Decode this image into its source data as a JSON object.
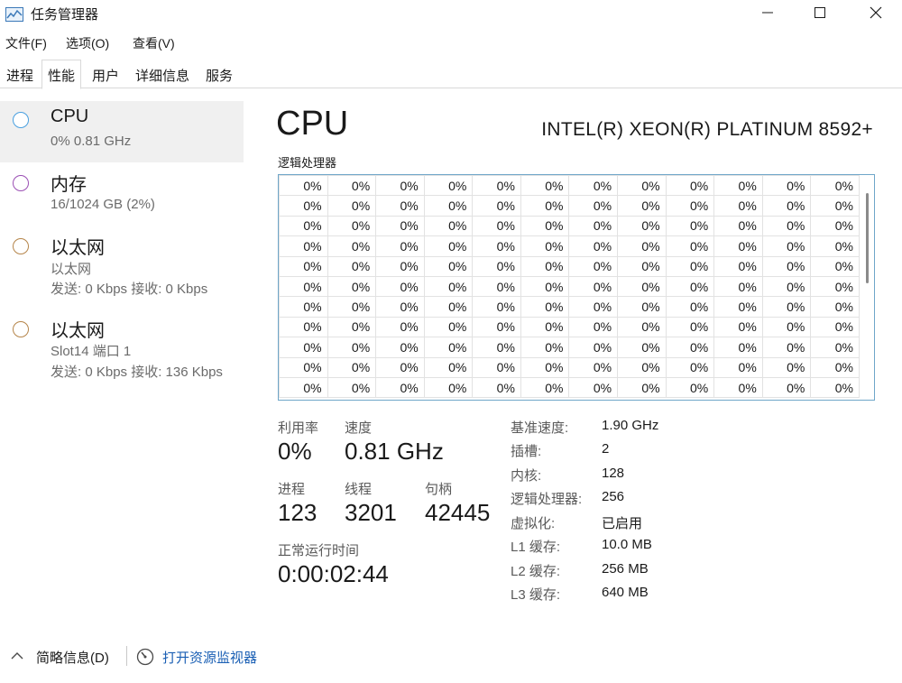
{
  "window": {
    "title": "任务管理器",
    "app_icon": "task-manager-icon",
    "controls": [
      "minimize-icon",
      "maximize-icon",
      "close-icon"
    ]
  },
  "menu": {
    "items": [
      "文件(F)",
      "选项(O)",
      "查看(V)"
    ]
  },
  "tabs": {
    "items": [
      "进程",
      "性能",
      "用户",
      "详细信息",
      "服务"
    ],
    "active": "性能"
  },
  "sidebar": {
    "items": [
      {
        "title": "CPU",
        "sub1": "0%  0.81 GHz",
        "sub2": "",
        "circle_color": "#4aa0e0",
        "selected": true
      },
      {
        "title": "内存",
        "sub1": "16/1024 GB (2%)",
        "sub2": "",
        "circle_color": "#9b4fb4",
        "selected": false
      },
      {
        "title": "以太网",
        "sub1": "以太网",
        "sub2": "发送: 0 Kbps  接收: 0 Kbps",
        "circle_color": "#b5854a",
        "selected": false
      },
      {
        "title": "以太网",
        "sub1": "Slot14 端口 1",
        "sub2": "发送: 0 Kbps  接收: 136 Kbps",
        "circle_color": "#b5854a",
        "selected": false
      }
    ]
  },
  "main": {
    "heading": "CPU",
    "model": "INTEL(R) XEON(R) PLATINUM 8592+",
    "grid_label": "逻辑处理器",
    "grid_cell_value": "0%",
    "grid_rows": 11,
    "grid_cols": 12,
    "border_color": "#6fa6c9"
  },
  "stats": {
    "utilization_label": "利用率",
    "utilization_value": "0%",
    "speed_label": "速度",
    "speed_value": "0.81 GHz",
    "processes_label": "进程",
    "processes_value": "123",
    "threads_label": "线程",
    "threads_value": "3201",
    "handles_label": "句柄",
    "handles_value": "42445",
    "uptime_label": "正常运行时间",
    "uptime_value": "0:00:02:44"
  },
  "specs": [
    {
      "label": "基准速度:",
      "value": "1.90 GHz"
    },
    {
      "label": "插槽:",
      "value": "2"
    },
    {
      "label": "内核:",
      "value": "128"
    },
    {
      "label": "逻辑处理器:",
      "value": "256"
    },
    {
      "label": "虚拟化:",
      "value": "已启用"
    },
    {
      "label": "L1 缓存:",
      "value": "10.0 MB"
    },
    {
      "label": "L2 缓存:",
      "value": "256 MB"
    },
    {
      "label": "L3 缓存:",
      "value": "640 MB"
    }
  ],
  "footer": {
    "summary": "简略信息(D)",
    "monitor_link": "打开资源监视器",
    "chevron_icon": "chevron-up-icon",
    "monitor_icon": "resource-monitor-icon"
  }
}
